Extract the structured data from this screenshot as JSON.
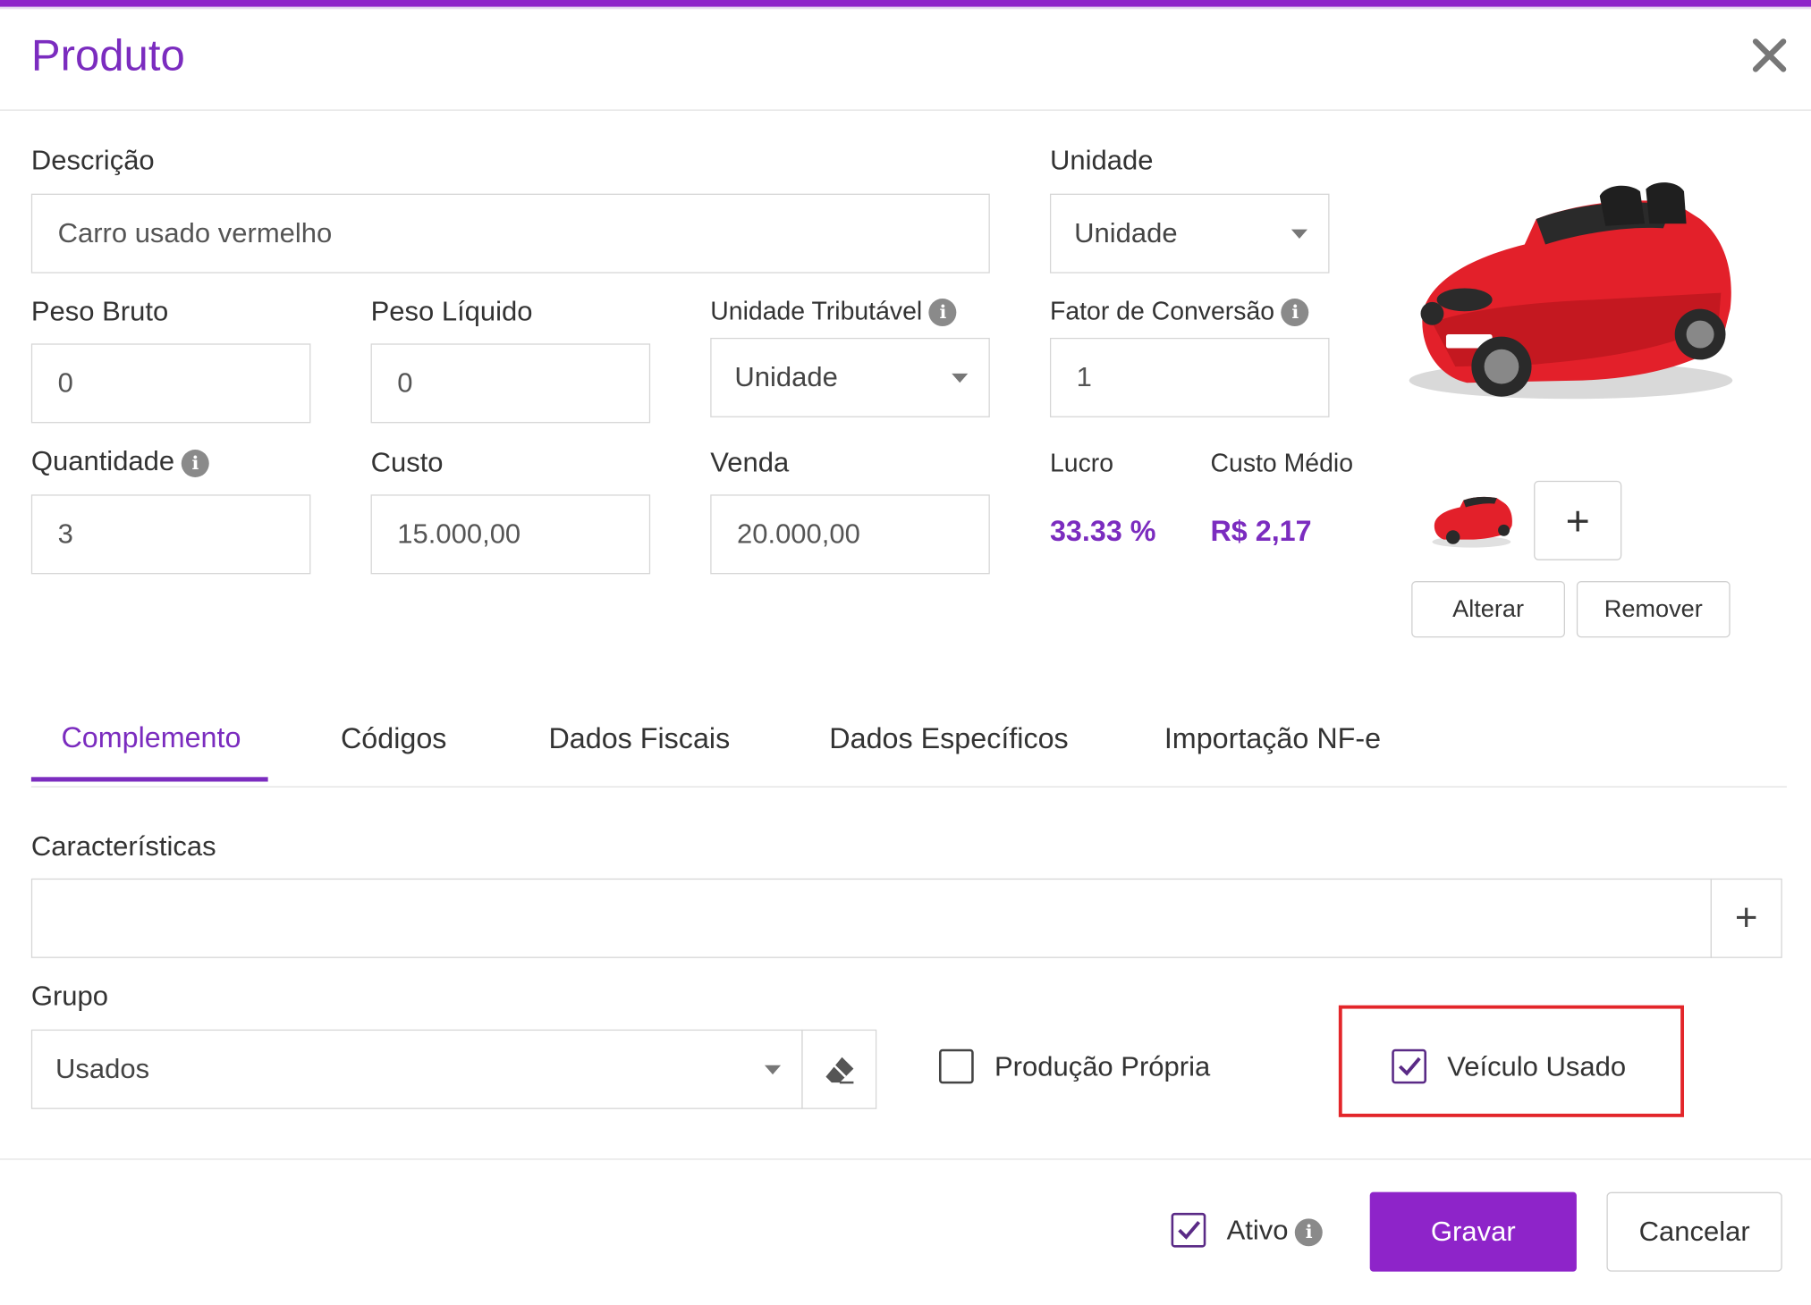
{
  "dialog": {
    "title": "Produto"
  },
  "form": {
    "descricao": {
      "label": "Descrição",
      "value": "Carro usado vermelho"
    },
    "unidade": {
      "label": "Unidade",
      "value": "Unidade"
    },
    "peso_bruto": {
      "label": "Peso Bruto",
      "value": "0"
    },
    "peso_liquido": {
      "label": "Peso Líquido",
      "value": "0"
    },
    "unidade_tributavel": {
      "label": "Unidade Tributável",
      "value": "Unidade"
    },
    "fator_conversao": {
      "label": "Fator de Conversão",
      "value": "1"
    },
    "quantidade": {
      "label": "Quantidade",
      "value": "3"
    },
    "custo": {
      "label": "Custo",
      "value": "15.000,00"
    },
    "venda": {
      "label": "Venda",
      "value": "20.000,00"
    },
    "lucro": {
      "label": "Lucro",
      "value": "33.33 %"
    },
    "custo_medio": {
      "label": "Custo Médio",
      "value": "R$ 2,17"
    }
  },
  "image": {
    "alterar_label": "Alterar",
    "remover_label": "Remover",
    "add_symbol": "+"
  },
  "tabs": [
    {
      "label": "Complemento",
      "active": true
    },
    {
      "label": "Códigos",
      "active": false
    },
    {
      "label": "Dados Fiscais",
      "active": false
    },
    {
      "label": "Dados Específicos",
      "active": false
    },
    {
      "label": "Importação NF-e",
      "active": false
    }
  ],
  "complemento": {
    "caracteristicas": {
      "label": "Características",
      "value": "",
      "add_symbol": "+"
    },
    "grupo": {
      "label": "Grupo",
      "value": "Usados"
    },
    "producao_propria": {
      "label": "Produção Própria",
      "checked": false
    },
    "veiculo_usado": {
      "label": "Veículo Usado",
      "checked": true
    }
  },
  "footer": {
    "ativo": {
      "label": "Ativo",
      "checked": true
    },
    "gravar_label": "Gravar",
    "cancelar_label": "Cancelar"
  },
  "icons": {
    "close": "close-icon",
    "info": "info-icon",
    "plus": "plus-icon",
    "eraser": "eraser-icon",
    "caret": "chevron-down-icon",
    "check": "check-icon"
  },
  "colors": {
    "accent": "#7b2cbf",
    "primary_button": "#8e24c9",
    "highlight": "#e3262a",
    "car": "#e3202a"
  }
}
